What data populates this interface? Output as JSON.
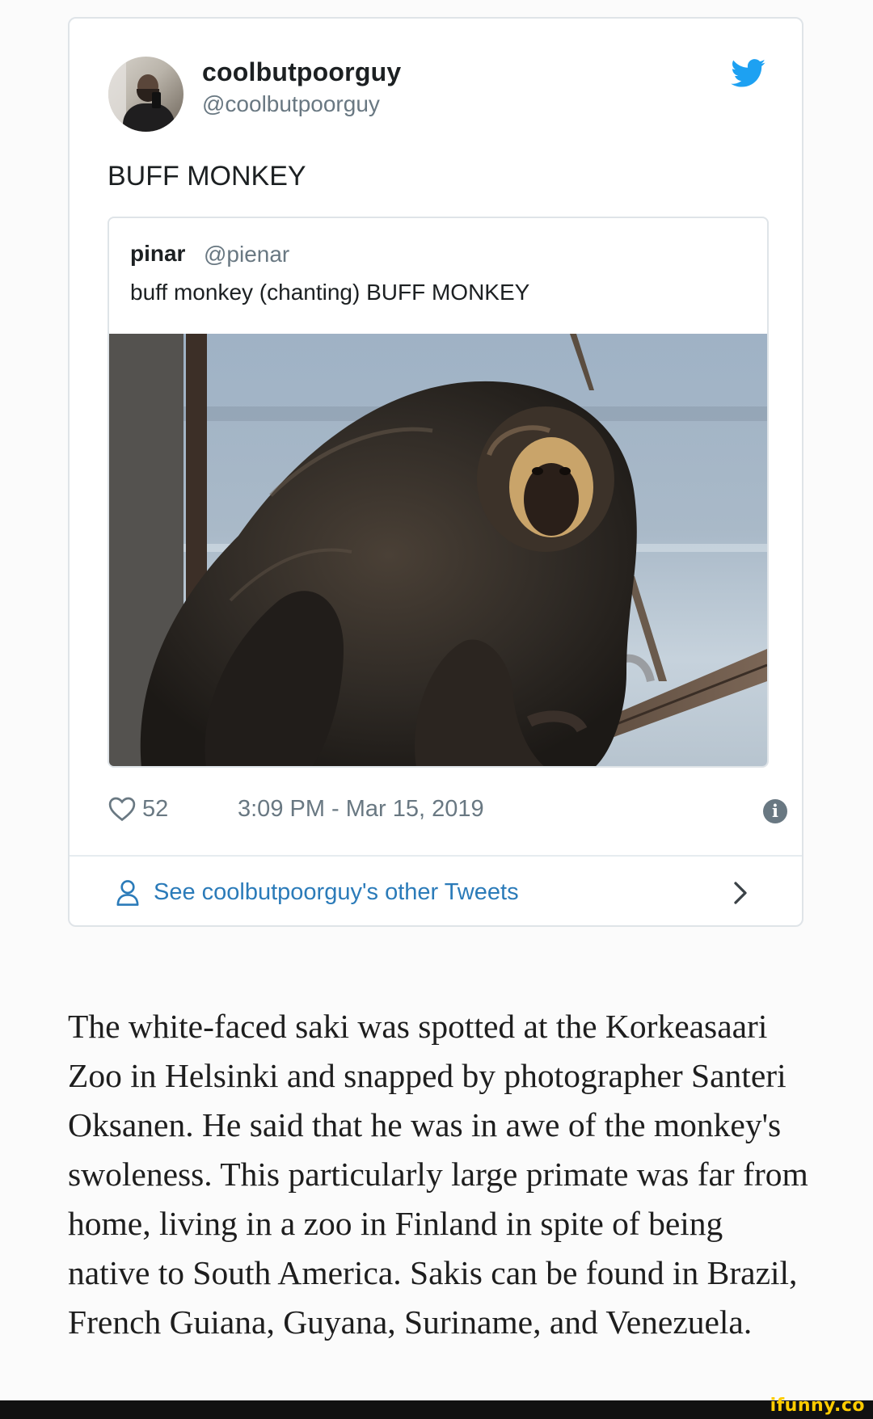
{
  "tweet": {
    "display_name": "coolbutpoorguy",
    "handle": "@coolbutpoorguy",
    "text": "BUFF MONKEY",
    "quoted": {
      "name": "pinar",
      "handle": "@pienar",
      "text": "buff monkey (chanting) BUFF MONKEY"
    },
    "likes": "52",
    "timestamp": "3:09 PM - Mar 15, 2019",
    "other_tweets_link": "See coolbutpoorguy's other Tweets"
  },
  "icons": {
    "bird": "twitter-bird-icon",
    "heart": "heart-icon",
    "info": "info-icon",
    "person": "person-icon",
    "chevron": "chevron-right-icon"
  },
  "colors": {
    "twitter_blue": "#1da1f2",
    "link_blue": "#2b7bb9",
    "muted_gray": "#697882",
    "ifunny_yellow": "#ffcc00"
  },
  "article": {
    "paragraph": "The white-faced saki was spotted at the Korkeasaari Zoo in Helsinki and snapped by photographer Santeri Oksanen. He said that he was in awe of the monkey's swoleness. This particularly large primate was far from home, living in a zoo in Finland in spite of being native to South America. Sakis can be found in Brazil, French Guiana, Guyana, Suriname, and Venezuela."
  },
  "watermark": "ifunny.co"
}
